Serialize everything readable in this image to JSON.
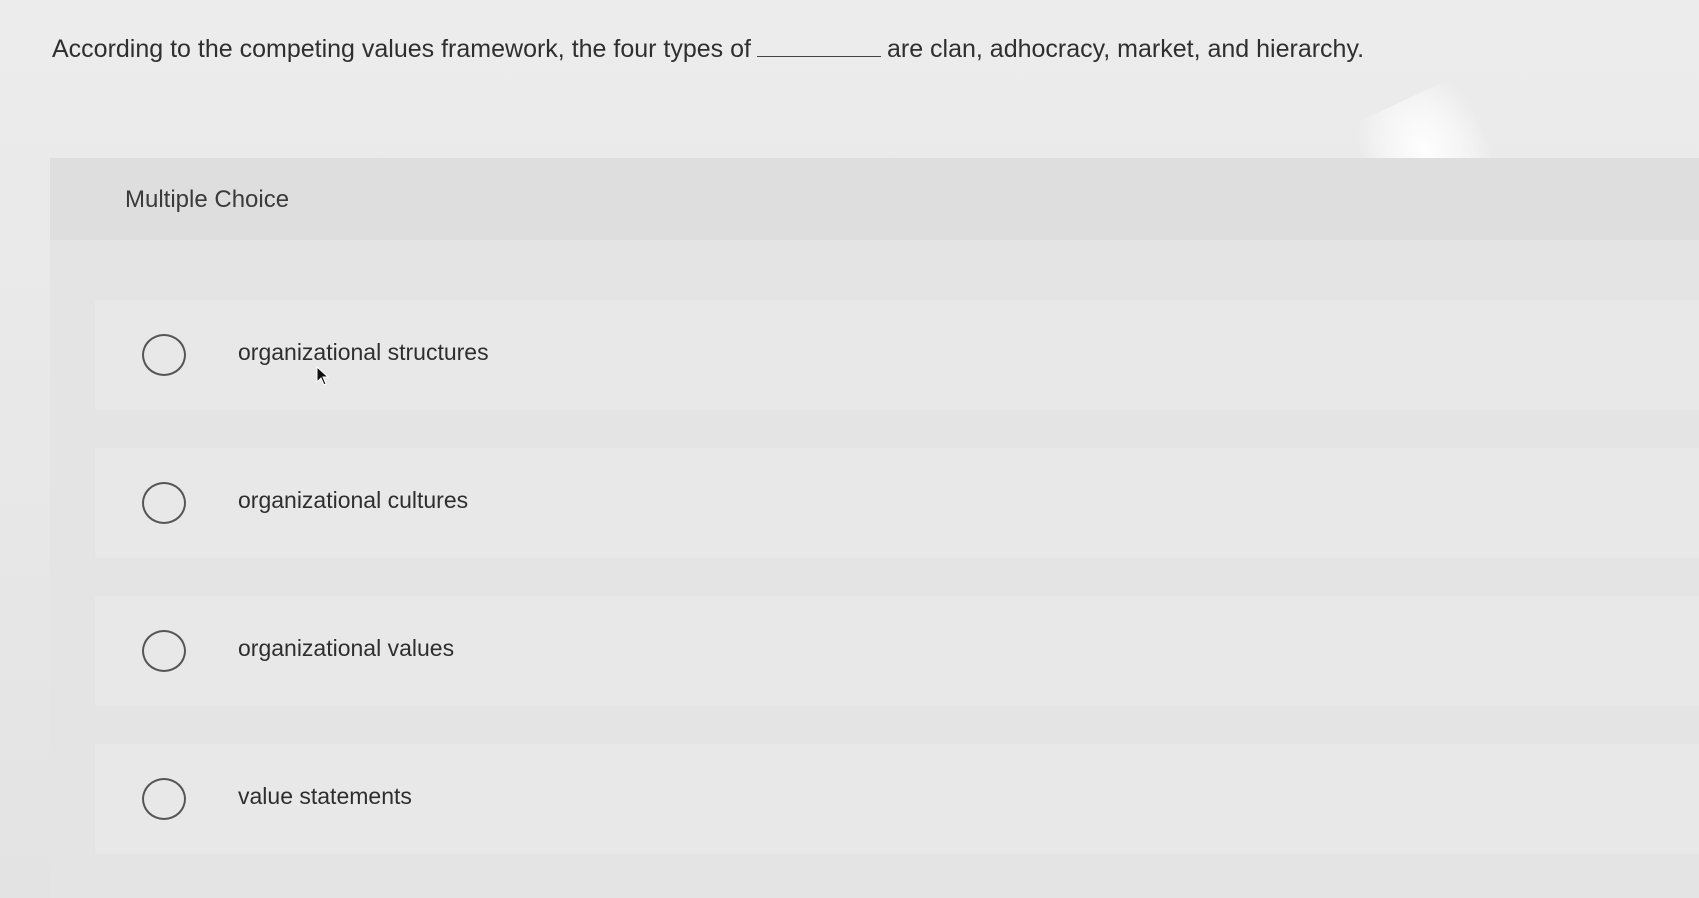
{
  "question": {
    "text_before": "According to the competing values framework, the four types of",
    "text_after": "are clan, adhocracy, market, and hierarchy."
  },
  "section": {
    "label": "Multiple Choice"
  },
  "options": [
    {
      "label": "organizational structures"
    },
    {
      "label": "organizational cultures"
    },
    {
      "label": "organizational values"
    },
    {
      "label": "value statements"
    }
  ]
}
